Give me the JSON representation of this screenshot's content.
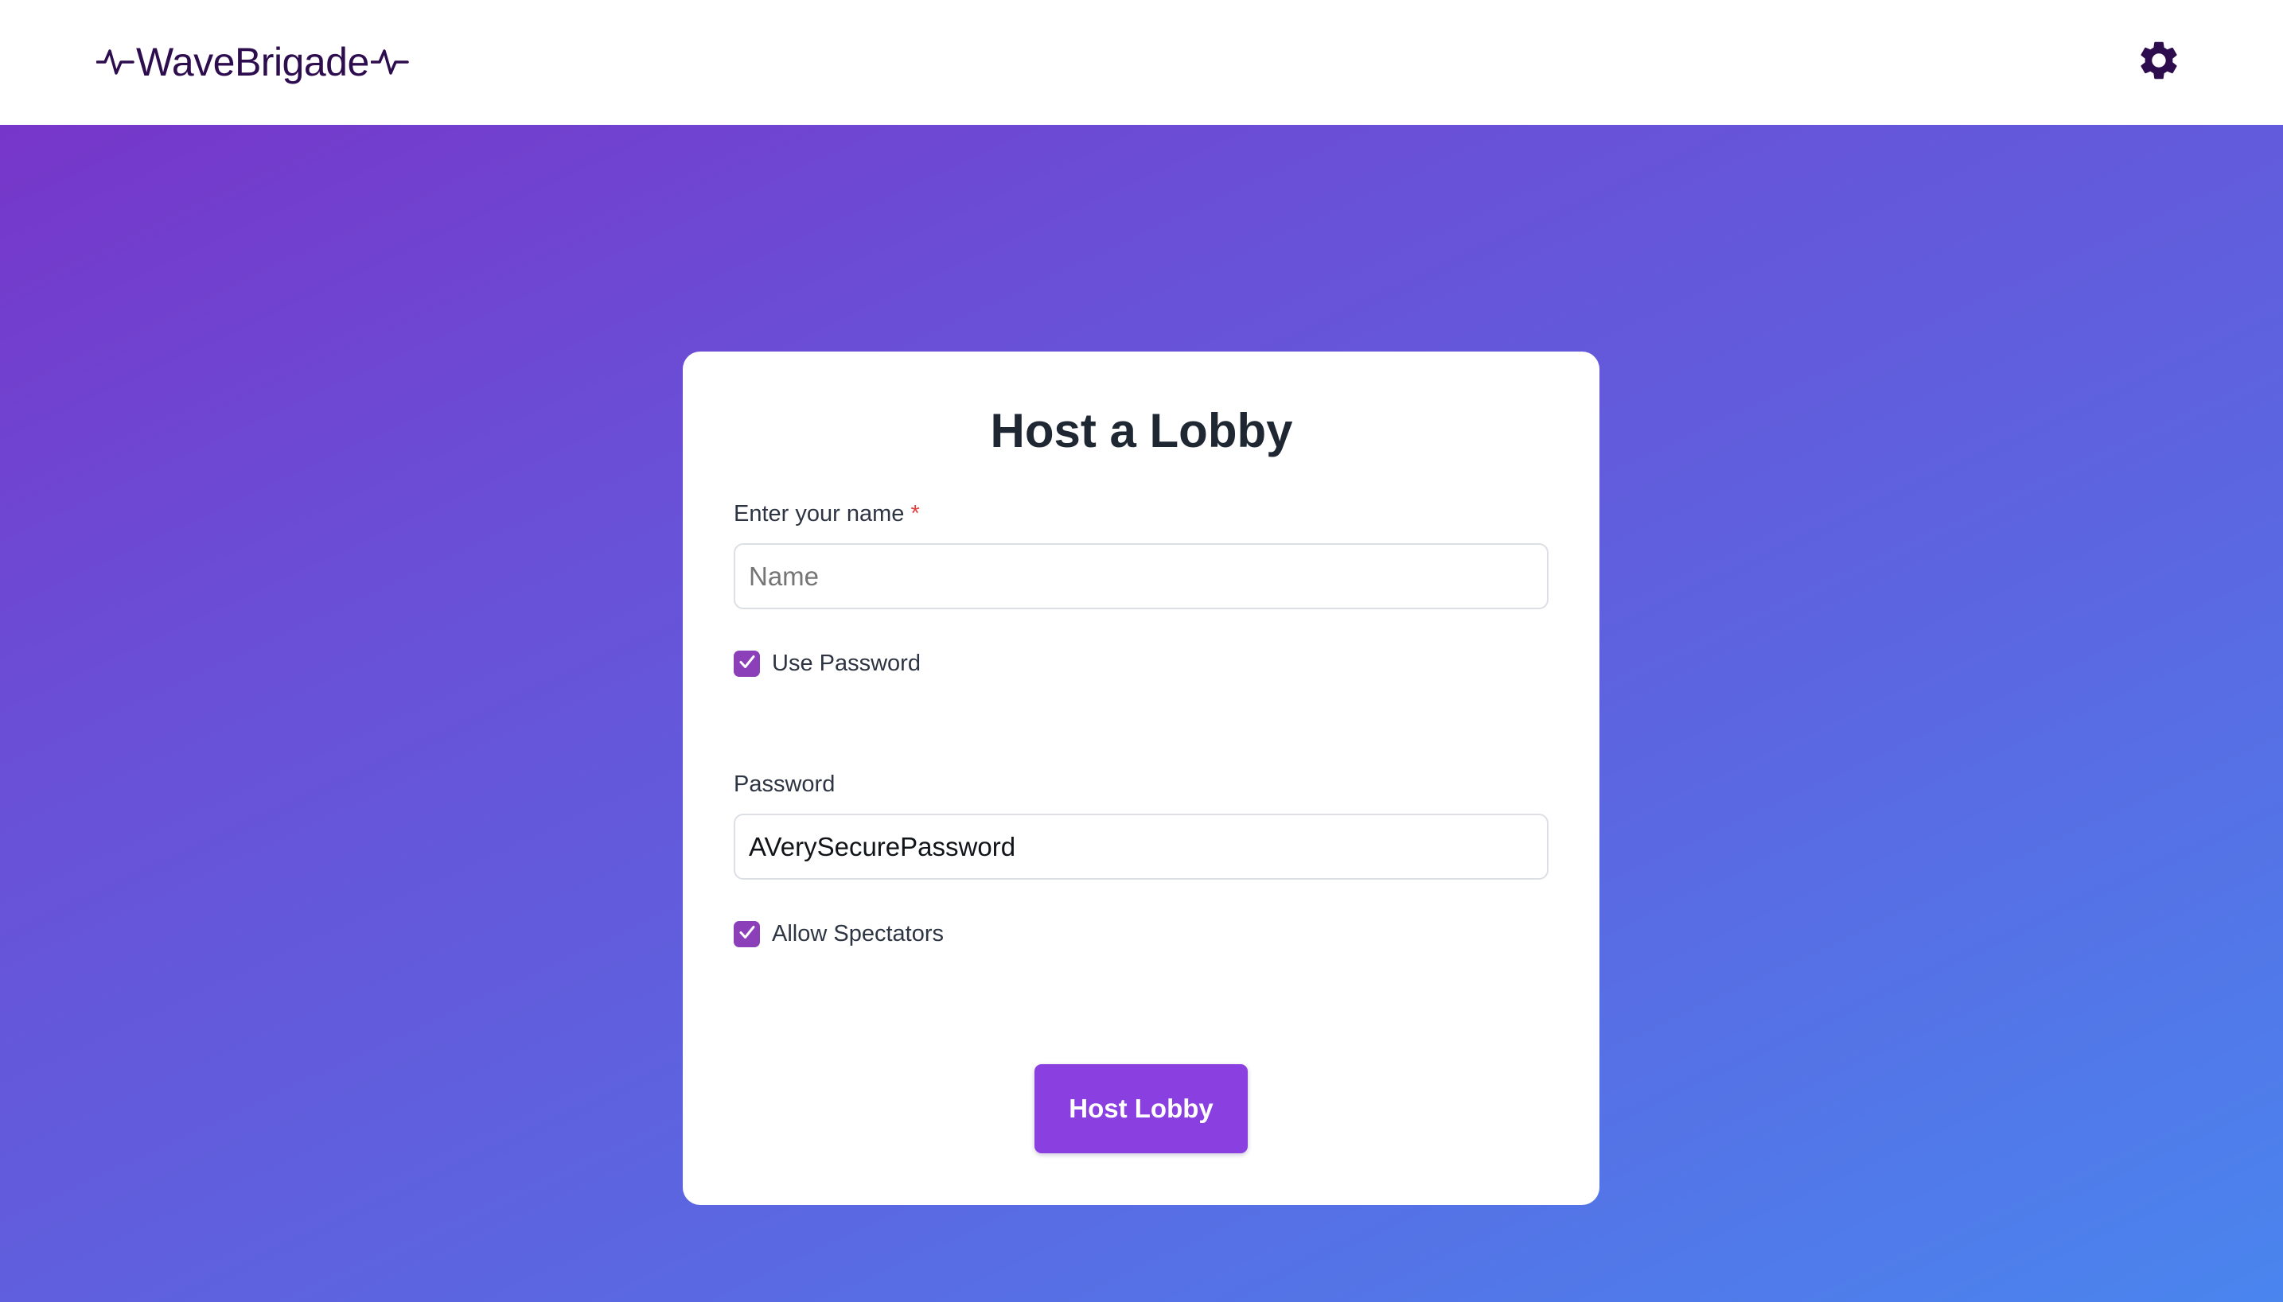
{
  "header": {
    "logo_text": "WaveBrigade",
    "logo_icon": "heartbeat-wave-icon",
    "settings_icon": "gear-icon"
  },
  "form": {
    "title": "Host a Lobby",
    "name_label": "Enter your name",
    "required_mark": "*",
    "name_placeholder": "Name",
    "name_value": "",
    "use_password_label": "Use Password",
    "use_password_checked": true,
    "password_label": "Password",
    "password_value": "AVerySecurePassword",
    "allow_spectators_label": "Allow Spectators",
    "allow_spectators_checked": true,
    "submit_label": "Host Lobby"
  },
  "colors": {
    "brand_dark": "#2e0d4f",
    "accent_purple": "#8a3fe0",
    "checkbox_purple": "#8b3fb8",
    "required_red": "#e53e3e",
    "gradient_start": "#7636c9",
    "gradient_end": "#4a85ee"
  }
}
